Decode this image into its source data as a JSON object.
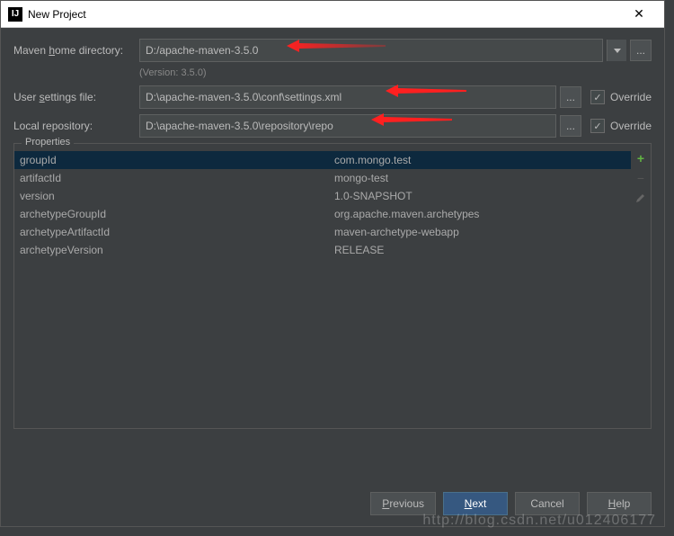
{
  "window": {
    "title": "New Project",
    "close": "✕"
  },
  "mavenHome": {
    "label_pre": "Maven ",
    "label_u": "h",
    "label_post": "ome directory:",
    "value": "D:/apache-maven-3.5.0",
    "browse": "..."
  },
  "version": "(Version: 3.5.0)",
  "userSettings": {
    "label_pre": "User ",
    "label_u": "s",
    "label_post": "ettings file:",
    "value": "D:\\apache-maven-3.5.0\\conf\\settings.xml",
    "browse": "...",
    "overrideLabel": "Override"
  },
  "localRepo": {
    "label": "Local repository:",
    "value": "D:\\apache-maven-3.5.0\\repository\\repo",
    "browse": "...",
    "overrideLabel": "Override"
  },
  "propertiesTitle": "Properties",
  "properties": [
    {
      "key": "groupId",
      "val": "com.mongo.test"
    },
    {
      "key": "artifactId",
      "val": "mongo-test"
    },
    {
      "key": "version",
      "val": "1.0-SNAPSHOT"
    },
    {
      "key": "archetypeGroupId",
      "val": "org.apache.maven.archetypes"
    },
    {
      "key": "archetypeArtifactId",
      "val": "maven-archetype-webapp"
    },
    {
      "key": "archetypeVersion",
      "val": "RELEASE"
    }
  ],
  "buttons": {
    "previous": "Previous",
    "next": "Next",
    "cancel": "Cancel",
    "help": "Help"
  },
  "watermark": "http://blog.csdn.net/u012406177"
}
